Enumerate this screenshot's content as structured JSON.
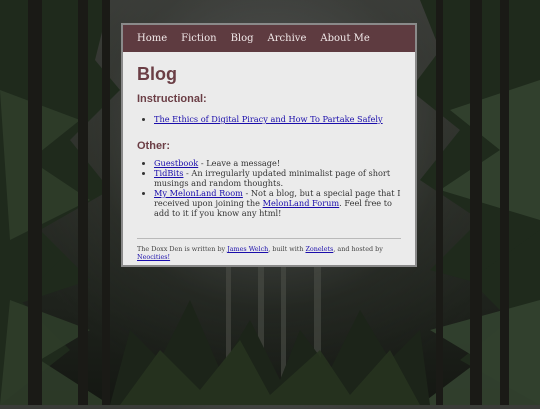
{
  "nav": {
    "items": [
      "Home",
      "Fiction",
      "Blog",
      "Archive",
      "About Me"
    ]
  },
  "page": {
    "title": "Blog",
    "sections": {
      "instructional": {
        "heading": "Instructional:",
        "items": [
          {
            "link": "The Ethics of Digital Piracy and How To Partake Safely",
            "text": ""
          }
        ]
      },
      "other": {
        "heading": "Other:",
        "items": [
          {
            "link": "Guestbook",
            "text": " - Leave a message!"
          },
          {
            "link": "TidBits",
            "text": " - An irregularly updated minimalist page of short musings and random thoughts."
          },
          {
            "link": "My MelonLand Room",
            "text": " - Not a blog, but a special page that I received upon joining the ",
            "link2": "MelonLand Forum",
            "text2": ". Feel free to add to it if you know any html!"
          }
        ]
      }
    }
  },
  "footer": {
    "prefix": "The Doxx Den is written by ",
    "author": "James Welch",
    "mid1": ", built with ",
    "tool": "Zonelets",
    "mid2": ", and hosted by ",
    "host": "Neocities!"
  },
  "colors": {
    "nav_bg": "#5e3b40",
    "heading": "#6b3e45",
    "card_bg": "#ebebeb",
    "link": "#1a0dab"
  }
}
